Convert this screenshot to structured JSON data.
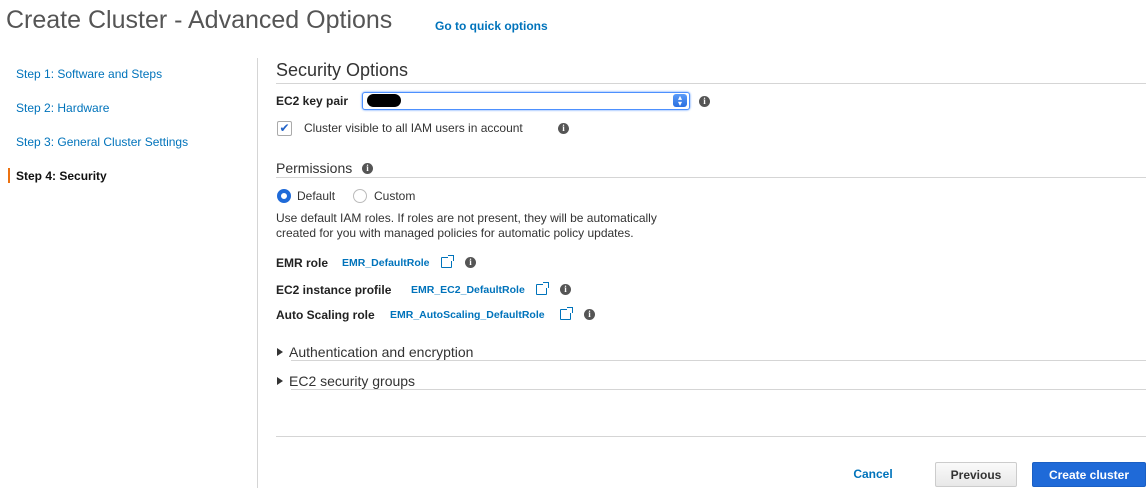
{
  "header": {
    "title": "Create Cluster - Advanced Options",
    "quick_link": "Go to quick options"
  },
  "sidebar": {
    "steps": [
      {
        "label": "Step 1: Software and Steps",
        "active": false
      },
      {
        "label": "Step 2: Hardware",
        "active": false
      },
      {
        "label": "Step 3: General Cluster Settings",
        "active": false
      },
      {
        "label": "Step 4: Security",
        "active": true
      }
    ]
  },
  "security": {
    "title": "Security Options",
    "key_pair_label": "EC2 key pair",
    "key_pair_value": "",
    "visible_checkbox_label": "Cluster visible to all IAM users in account",
    "visible_checked": true
  },
  "permissions": {
    "title": "Permissions",
    "options": [
      "Default",
      "Custom"
    ],
    "selected": "Default",
    "description_line1": "Use default IAM roles. If roles are not present, they will be automatically",
    "description_line2": "created for you with managed policies for automatic policy updates.",
    "emr_role_label": "EMR role",
    "emr_role_value": "EMR_DefaultRole",
    "instance_profile_label": "EC2 instance profile",
    "instance_profile_value": "EMR_EC2_DefaultRole",
    "autoscaling_label": "Auto Scaling role",
    "autoscaling_value": "EMR_AutoScaling_DefaultRole"
  },
  "expanders": {
    "auth": "Authentication and encryption",
    "security_groups": "EC2 security groups"
  },
  "footer": {
    "cancel": "Cancel",
    "previous": "Previous",
    "create": "Create cluster"
  },
  "colors": {
    "link": "#0073bb",
    "primary": "#1f6ad8",
    "active_marker": "#ec7211"
  },
  "icons": {
    "info": "info-circle",
    "external": "external-link",
    "check": "checkmark",
    "expand": "caret-right",
    "select": "select-arrows"
  }
}
